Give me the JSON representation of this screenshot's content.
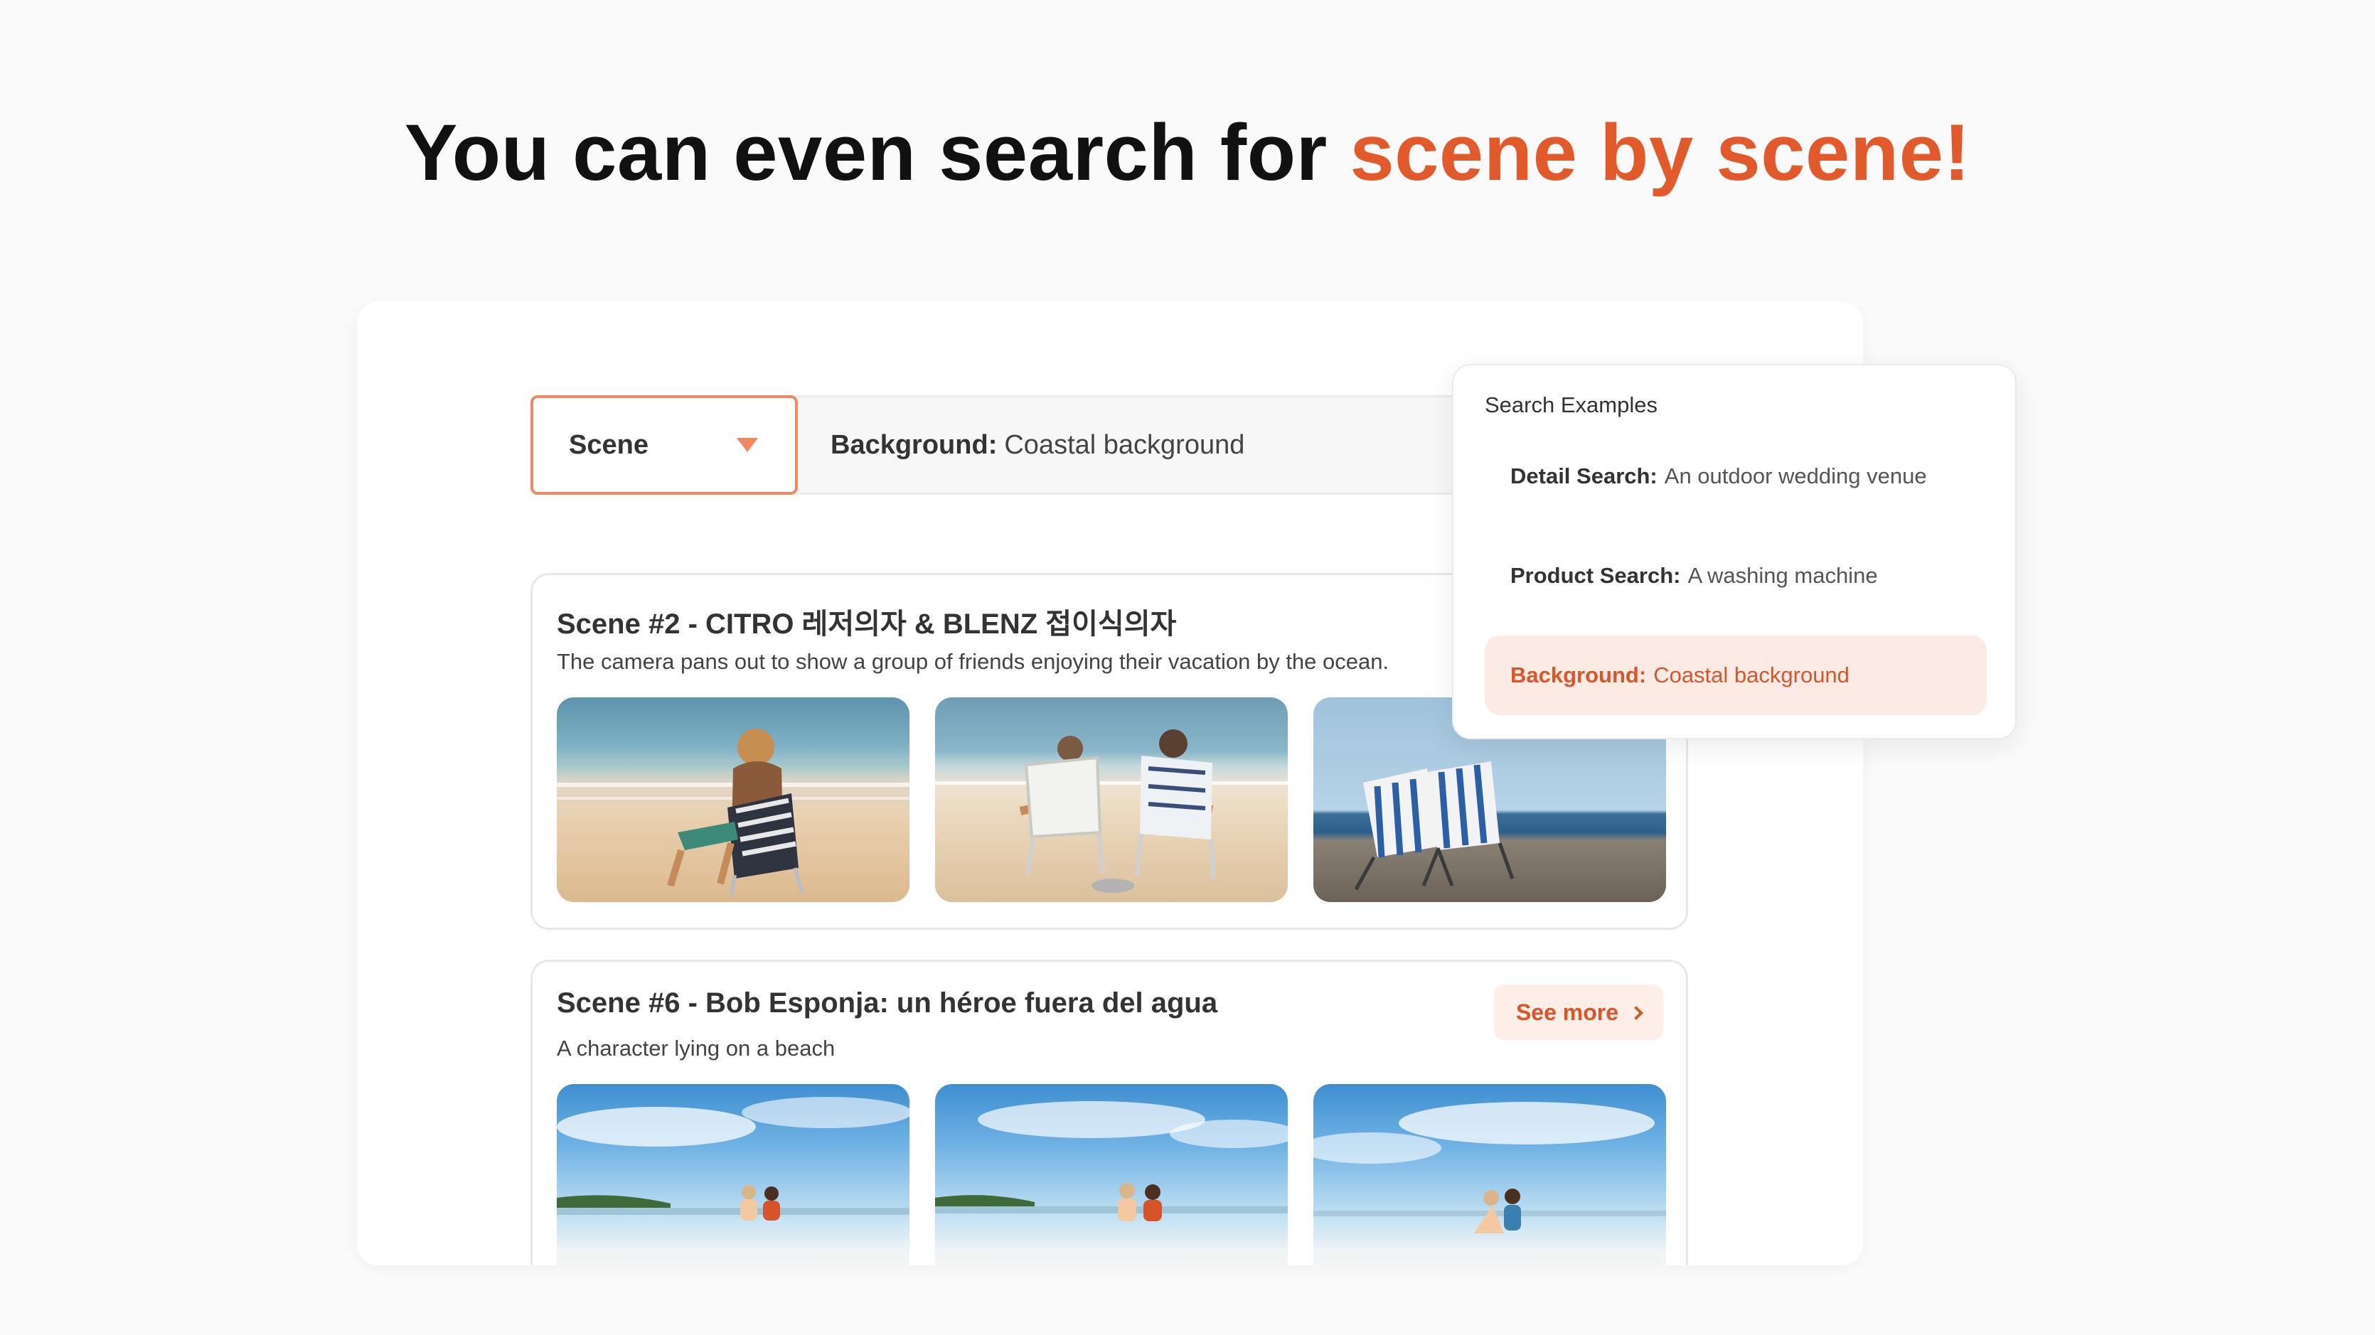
{
  "headline": {
    "text": "You can even search for ",
    "accent": "scene by scene!"
  },
  "search": {
    "mode": "Scene",
    "query_label": "Background:",
    "query_value": "Coastal background"
  },
  "results": [
    {
      "title": "Scene #2 - CITRO 레저의자 & BLENZ 접이식의자",
      "description": "The camera pans out to show a group of friends enjoying their vacation by the ocean."
    },
    {
      "title": "Scene #6 - Bob Esponja: un héroe fuera del agua",
      "description": "A character lying on a beach",
      "see_more": "See more"
    }
  ],
  "examples": {
    "title": "Search Examples",
    "items": [
      {
        "label": "Detail Search:",
        "value": "An outdoor wedding venue",
        "active": false
      },
      {
        "label": "Product Search:",
        "value": "A washing machine",
        "active": false
      },
      {
        "label": "Background:",
        "value": "Coastal background",
        "active": true
      }
    ]
  },
  "colors": {
    "accent": "#e25a2c",
    "accent_light": "#fcebe4"
  }
}
